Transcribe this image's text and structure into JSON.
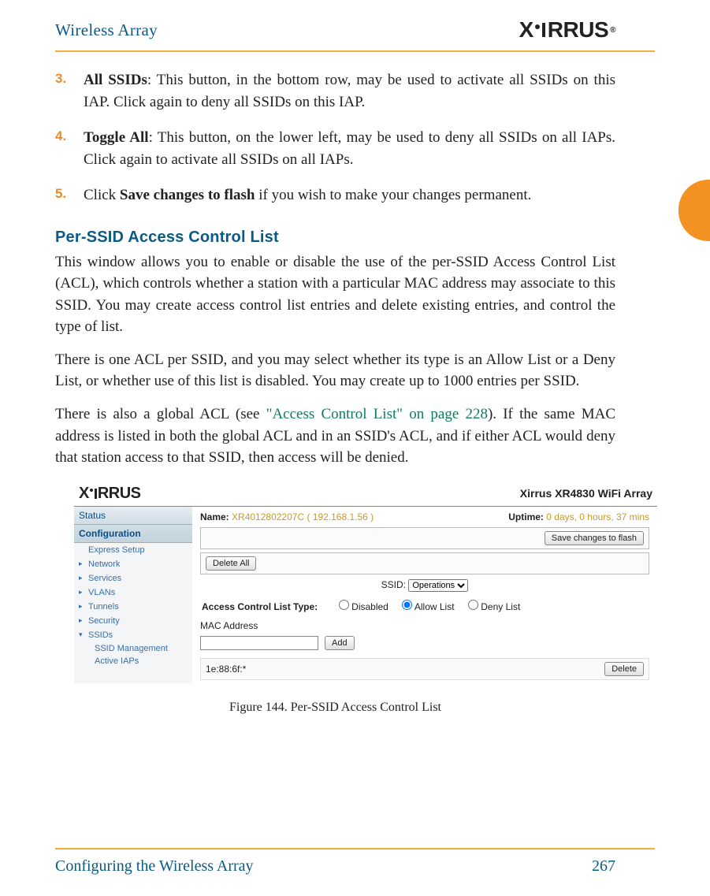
{
  "header": {
    "left": "Wireless Array",
    "logo": "XIRRUS"
  },
  "list": {
    "item3": {
      "num": "3.",
      "bold": "All SSIDs",
      "rest": ": This button, in the bottom row, may be used to activate all SSIDs on this IAP. Click again to deny all SSIDs on this IAP."
    },
    "item4": {
      "num": "4.",
      "bold": "Toggle All",
      "rest": ": This button, on the lower left, may be used to deny all SSIDs on all IAPs. Click again to activate all SSIDs on all IAPs."
    },
    "item5": {
      "num": "5.",
      "pre": "Click ",
      "bold": "Save changes to flash",
      "rest": " if you wish to make your changes permanent."
    }
  },
  "section": {
    "head": "Per-SSID Access Control List"
  },
  "para1": "This window allows you to enable or disable the use of the per-SSID Access Control List (ACL), which controls whether a station with a particular MAC address may associate to this SSID. You may create access control list entries and delete existing entries, and control the type of list.",
  "para2": "There is one ACL per SSID, and you may select whether its type is an Allow List or a Deny List, or whether use of this list is disabled. You may create up to 1000 entries per SSID.",
  "para3": {
    "pre": "There is also a global ACL (see ",
    "ref": "\"Access Control List\" on page 228",
    "post": "). If the same MAC address is listed in both the global ACL and in an SSID's ACL, and if either ACL would deny that station access to that SSID, then access will be denied."
  },
  "ui": {
    "title": "Xirrus XR4830 WiFi Array",
    "logo": "XIRRUS",
    "side": {
      "status": "Status",
      "config": "Configuration",
      "express": "Express Setup",
      "network": "Network",
      "services": "Services",
      "vlans": "VLANs",
      "tunnels": "Tunnels",
      "security": "Security",
      "ssids": "SSIDs",
      "ssid_mgmt": "SSID Management",
      "active_iaps": "Active IAPs"
    },
    "name_label": "Name:",
    "name_value": "XR4012802207C   ( 192.168.1.56 )",
    "uptime_label": "Uptime:",
    "uptime_value": "0 days, 0 hours, 37 mins",
    "save_btn": "Save changes to flash",
    "delete_all_btn": "Delete All",
    "ssid_label": "SSID:",
    "ssid_value": "Operations",
    "acl_label": "Access Control List Type:",
    "acl_disabled": "Disabled",
    "acl_allow": "Allow List",
    "acl_deny": "Deny List",
    "mac_label": "MAC Address",
    "add_btn": "Add",
    "list_entry": "1e:88:6f:*",
    "delete_btn": "Delete"
  },
  "figure": "Figure 144. Per-SSID Access Control List",
  "footer": {
    "left": "Configuring the Wireless Array",
    "page": "267"
  }
}
